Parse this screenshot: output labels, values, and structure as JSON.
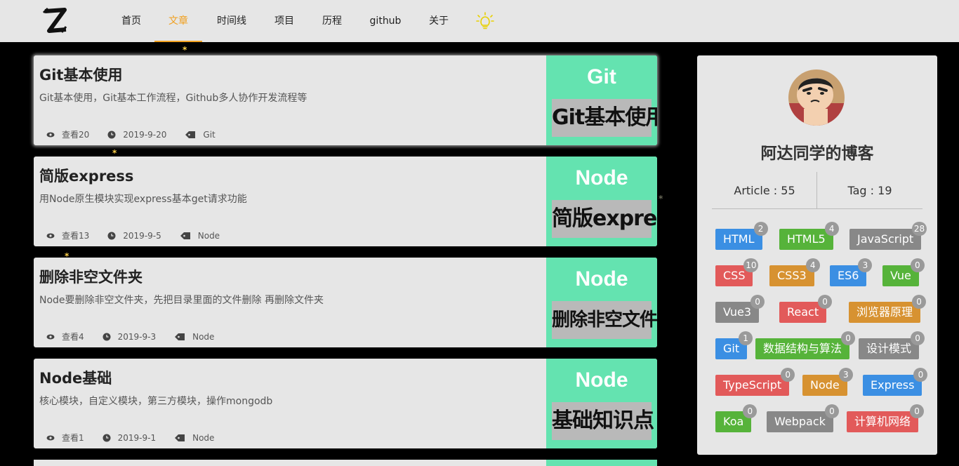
{
  "nav": {
    "logo_text": "Z",
    "items": [
      "首页",
      "文章",
      "时间线",
      "项目",
      "历程",
      "github",
      "关于"
    ],
    "active_index": 1
  },
  "articles": [
    {
      "title": "Git基本使用",
      "desc": "Git基本使用，Git基本工作流程，Github多人协作开发流程等",
      "views": "查看20",
      "date": "2019-9-20",
      "tag": "Git",
      "thumb_title": "Git",
      "thumb_sub": "Git基本使用"
    },
    {
      "title": "简版express",
      "desc": "用Node原生模块实现express基本get请求功能",
      "views": "查看13",
      "date": "2019-9-5",
      "tag": "Node",
      "thumb_title": "Node",
      "thumb_sub": "简版express"
    },
    {
      "title": "删除非空文件夹",
      "desc": "Node要删除非空文件夹，先把目录里面的文件删除 再删除文件夹",
      "views": "查看4",
      "date": "2019-9-3",
      "tag": "Node",
      "thumb_title": "Node",
      "thumb_sub": "删除非空文件夹"
    },
    {
      "title": "Node基础",
      "desc": "核心模块，自定义模块，第三方模块，操作mongodb",
      "views": "查看1",
      "date": "2019-9-1",
      "tag": "Node",
      "thumb_title": "Node",
      "thumb_sub": "基础知识点"
    }
  ],
  "sidebar": {
    "blog_name": "阿达同学的博客",
    "article_stat": "Article : 55",
    "tag_stat": "Tag : 19",
    "tags": [
      {
        "label": "HTML",
        "count": "2",
        "color": "#3b8fe3"
      },
      {
        "label": "HTML5",
        "count": "4",
        "color": "#56b33a"
      },
      {
        "label": "JavaScript",
        "count": "28",
        "color": "#888888"
      },
      {
        "label": "CSS",
        "count": "10",
        "color": "#e25a5a"
      },
      {
        "label": "CSS3",
        "count": "4",
        "color": "#d79231"
      },
      {
        "label": "ES6",
        "count": "3",
        "color": "#3b8fe3"
      },
      {
        "label": "Vue",
        "count": "0",
        "color": "#56b33a"
      },
      {
        "label": "Vue3",
        "count": "0",
        "color": "#888888"
      },
      {
        "label": "React",
        "count": "0",
        "color": "#e25a5a"
      },
      {
        "label": "浏览器原理",
        "count": "0",
        "color": "#d79231"
      },
      {
        "label": "Git",
        "count": "1",
        "color": "#3b8fe3"
      },
      {
        "label": "数据结构与算法",
        "count": "0",
        "color": "#56b33a"
      },
      {
        "label": "设计模式",
        "count": "0",
        "color": "#888888"
      },
      {
        "label": "TypeScript",
        "count": "0",
        "color": "#e25a5a"
      },
      {
        "label": "Node",
        "count": "3",
        "color": "#d79231"
      },
      {
        "label": "Express",
        "count": "0",
        "color": "#3b8fe3"
      },
      {
        "label": "Koa",
        "count": "0",
        "color": "#56b33a"
      },
      {
        "label": "Webpack",
        "count": "0",
        "color": "#888888"
      },
      {
        "label": "计算机网络",
        "count": "0",
        "color": "#e25a5a"
      }
    ]
  },
  "colors": {
    "accent": "#f0a020",
    "thumb_bg": "#64e3b0",
    "page_bg": "#000000",
    "card_bg": "#e6e6e6"
  }
}
